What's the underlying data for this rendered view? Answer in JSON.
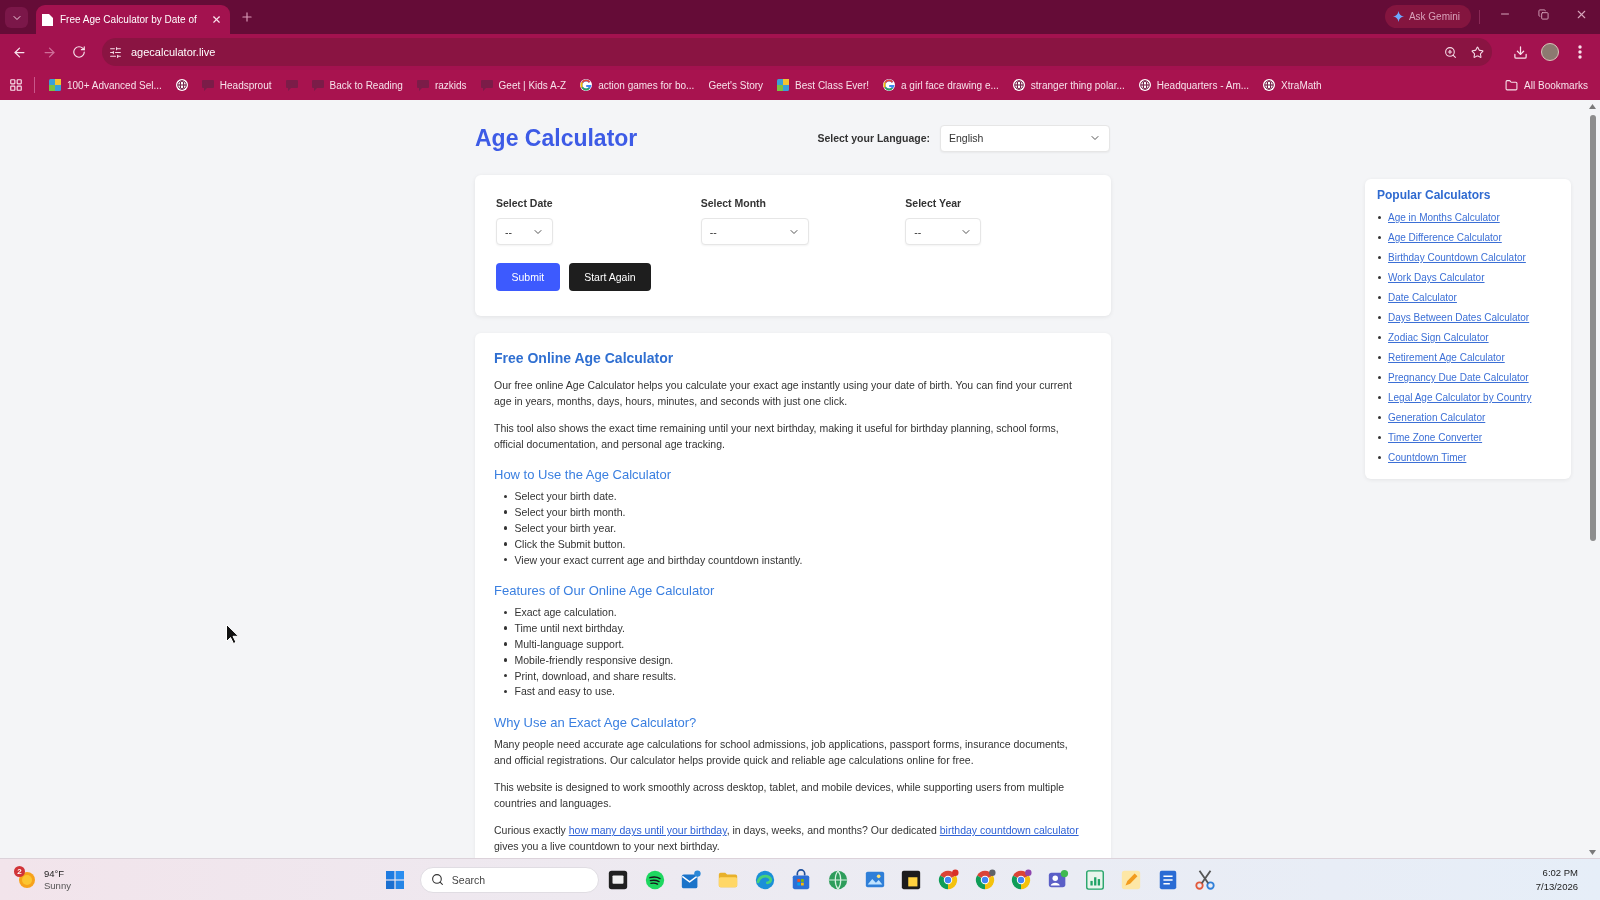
{
  "browser": {
    "tabs": [
      {
        "title": "Free Age Calculator by Date of",
        "selected": true
      }
    ],
    "ask_button": "Ask Gemini",
    "forward_disabled": true,
    "address": "agecalculator.live",
    "bookmarks": [
      {
        "kind": "tile",
        "label": "100+ Advanced Sel..."
      },
      {
        "kind": "globe"
      },
      {
        "kind": "faint",
        "label": "Headsprout"
      },
      {
        "kind": "faint"
      },
      {
        "kind": "faint",
        "label": "Back to Reading"
      },
      {
        "kind": "faint",
        "label": "razkids"
      },
      {
        "kind": "faint",
        "label": "Geet | Kids A-Z"
      },
      {
        "kind": "ring",
        "label": "action games for bo..."
      },
      {
        "label": "Geet's Story"
      },
      {
        "kind": "tile",
        "label": "Best Class Ever!"
      },
      {
        "kind": "ring",
        "label": "a girl face drawing e..."
      },
      {
        "kind": "globe",
        "label": "stranger thing polar..."
      },
      {
        "kind": "globe",
        "label": "Headquarters - Am..."
      },
      {
        "kind": "globe",
        "label": "XtraMath"
      }
    ],
    "all_bookmarks": "All Bookmarks"
  },
  "page": {
    "title": "Age Calculator",
    "language": {
      "label": "Select your Language:",
      "value": "English"
    },
    "form": {
      "fields": [
        {
          "label": "Select Date",
          "value": "--"
        },
        {
          "label": "Select Month",
          "value": "--"
        },
        {
          "label": "Select Year",
          "value": "--"
        }
      ],
      "buttons": [
        {
          "kind": "primary",
          "label": "Submit"
        },
        {
          "kind": "dark",
          "label": "Start Again"
        }
      ]
    },
    "article": {
      "sections": [
        {
          "kind": "main",
          "heading": "Free Online Age Calculator",
          "blocks": [
            {
              "kind": "paragraph",
              "text": "Our free online Age Calculator helps you calculate your exact age instantly using your date of birth. You can find your current age in years, months, days, hours, minutes, and seconds with just one click."
            },
            {
              "kind": "paragraph",
              "text": "This tool also shows the exact time remaining until your next birthday, making it useful for birthday planning, school forms, official documentation, and personal age tracking."
            }
          ]
        },
        {
          "kind": "sub",
          "heading": "How to Use the Age Calculator",
          "blocks": [
            {
              "kind": "list",
              "items": [
                "Select your birth date.",
                "Select your birth month.",
                "Select your birth year.",
                "Click the Submit button.",
                "View your exact current age and birthday countdown instantly."
              ]
            }
          ]
        },
        {
          "kind": "sub",
          "heading": "Features of Our Online Age Calculator",
          "blocks": [
            {
              "kind": "list",
              "items": [
                "Exact age calculation.",
                "Time until next birthday.",
                "Multi-language support.",
                "Mobile-friendly responsive design.",
                "Print, download, and share results.",
                "Fast and easy to use."
              ]
            }
          ]
        },
        {
          "kind": "sub",
          "heading": "Why Use an Exact Age Calculator?",
          "blocks": [
            {
              "kind": "paragraph",
              "text": "Many people need accurate age calculations for school admissions, job applications, passport forms, insurance documents, and official registrations. Our calculator helps provide quick and reliable age calculations online for free."
            },
            {
              "kind": "paragraph",
              "text": "This website is designed to work smoothly across desktop, tablet, and mobile devices, while supporting users from multiple countries and languages."
            },
            {
              "kind": "paragraph",
              "parts": [
                {
                  "kind": "text",
                  "text": "Curious exactly "
                },
                {
                  "kind": "link",
                  "text": "how many days until your birthday"
                },
                {
                  "kind": "text",
                  "text": ", in days, weeks, and months? Our dedicated "
                },
                {
                  "kind": "link",
                  "text": "birthday countdown calculator"
                },
                {
                  "kind": "text",
                  "text": " gives you a live countdown to your next birthday."
                }
              ]
            }
          ]
        }
      ]
    },
    "sidebar": {
      "title": "Popular Calculators",
      "links": [
        "Age in Months Calculator",
        "Age Difference Calculator",
        "Birthday Countdown Calculator",
        "Work Days Calculator",
        "Date Calculator",
        "Days Between Dates Calculator",
        "Zodiac Sign Calculator",
        "Retirement Age Calculator",
        "Pregnancy Due Date Calculator",
        "Legal Age Calculator by Country",
        "Generation Calculator",
        "Time Zone Converter",
        "Countdown Timer"
      ]
    }
  },
  "taskbar": {
    "weather": {
      "badge": "2",
      "temperature": "94°F",
      "condition": "Sunny"
    },
    "search": {
      "placeholder": "Search"
    },
    "time": "6:02 PM",
    "date": "7/13/2026"
  }
}
